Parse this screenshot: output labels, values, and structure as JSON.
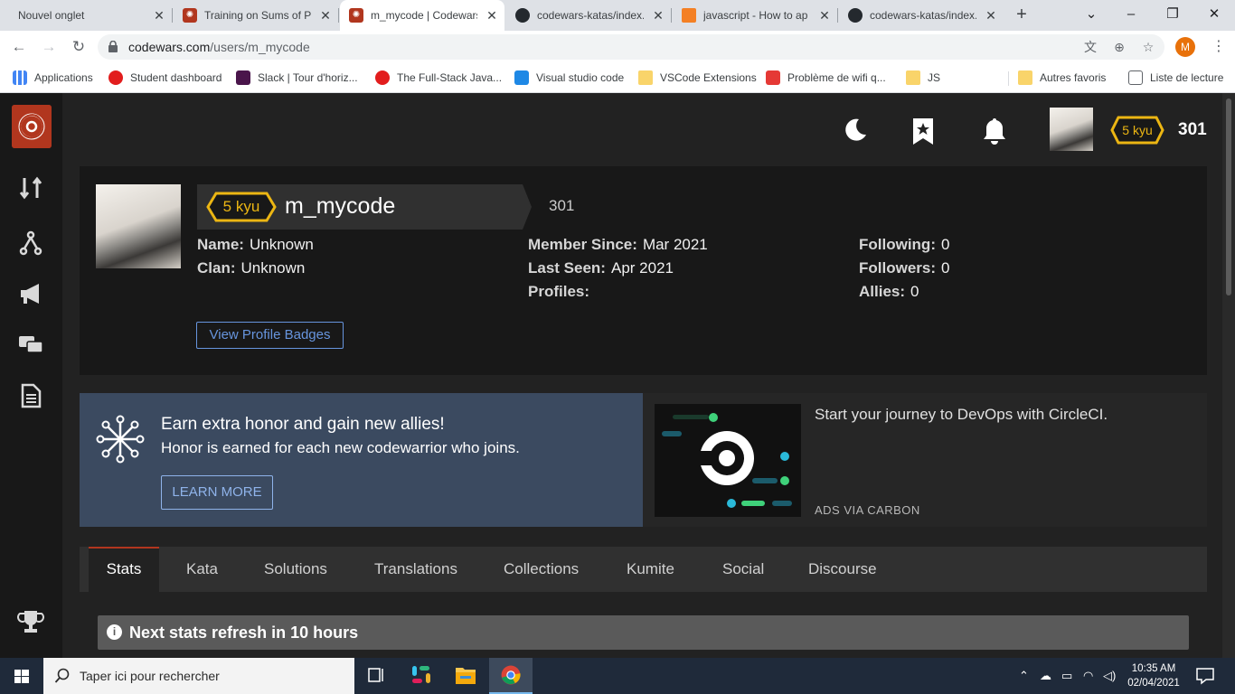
{
  "browser": {
    "tabs": [
      {
        "title": "Nouvel onglet",
        "favicon": "none"
      },
      {
        "title": "Training on Sums of Pa",
        "favicon": "codewars"
      },
      {
        "title": "m_mycode | Codewars",
        "favicon": "codewars",
        "active": true
      },
      {
        "title": "codewars-katas/index.",
        "favicon": "github"
      },
      {
        "title": "javascript - How to ap",
        "favicon": "stackoverflow"
      },
      {
        "title": "codewars-katas/index.",
        "favicon": "github"
      }
    ],
    "new_tab_label": "+",
    "window_controls": {
      "minimize": "–",
      "maximize": "❐",
      "close": "✕"
    },
    "url_host": "codewars.com",
    "url_path": "/users/m_mycode",
    "profile_initial": "M",
    "bookmarks": [
      {
        "label": "Applications",
        "icon": "apps-grid-icon"
      },
      {
        "label": "Student dashboard",
        "icon": "red-circle-icon"
      },
      {
        "label": "Slack | Tour d'horiz...",
        "icon": "slack-icon"
      },
      {
        "label": "The Full-Stack Java...",
        "icon": "red-circle-icon"
      },
      {
        "label": "Visual studio code",
        "icon": "vscode-icon"
      },
      {
        "label": "VSCode Extensions",
        "icon": "folder-icon"
      },
      {
        "label": "Problème de wifi q...",
        "icon": "c-icon"
      },
      {
        "label": "JS",
        "icon": "folder-icon"
      },
      {
        "label": "Autres favoris",
        "icon": "folder-icon"
      },
      {
        "label": "Liste de lecture",
        "icon": "reading-list-icon"
      }
    ]
  },
  "header": {
    "rank": "5 kyu",
    "honor": "301"
  },
  "profile": {
    "rank": "5 kyu",
    "username": "m_mycode",
    "honor": "301",
    "fields_left": [
      {
        "label": "Name:",
        "value": "Unknown"
      },
      {
        "label": "Clan:",
        "value": "Unknown"
      }
    ],
    "fields_middle": [
      {
        "label": "Member Since:",
        "value": "Mar 2021"
      },
      {
        "label": "Last Seen:",
        "value": "Apr 2021"
      },
      {
        "label": "Profiles:",
        "value": ""
      }
    ],
    "fields_right": [
      {
        "label": "Following:",
        "value": "0"
      },
      {
        "label": "Followers:",
        "value": "0"
      },
      {
        "label": "Allies:",
        "value": "0"
      }
    ],
    "badges_button": "View Profile Badges"
  },
  "promo": {
    "title": "Earn extra honor and gain new allies!",
    "text": "Honor is earned for each new codewarrior who joins.",
    "button": "LEARN MORE"
  },
  "ad": {
    "text": "Start your journey to DevOps with CircleCI.",
    "via": "ADS VIA CARBON"
  },
  "profile_tabs": [
    "Stats",
    "Kata",
    "Solutions",
    "Translations",
    "Collections",
    "Kumite",
    "Social",
    "Discourse"
  ],
  "notice": "Next stats refresh in 10 hours",
  "taskbar": {
    "search_placeholder": "Taper ici pour rechercher",
    "time": "10:35 AM",
    "date": "02/04/2021"
  },
  "colors": {
    "brand_red": "#b1361e",
    "rank_yellow": "#ecb613",
    "link_blue": "#6795de"
  }
}
